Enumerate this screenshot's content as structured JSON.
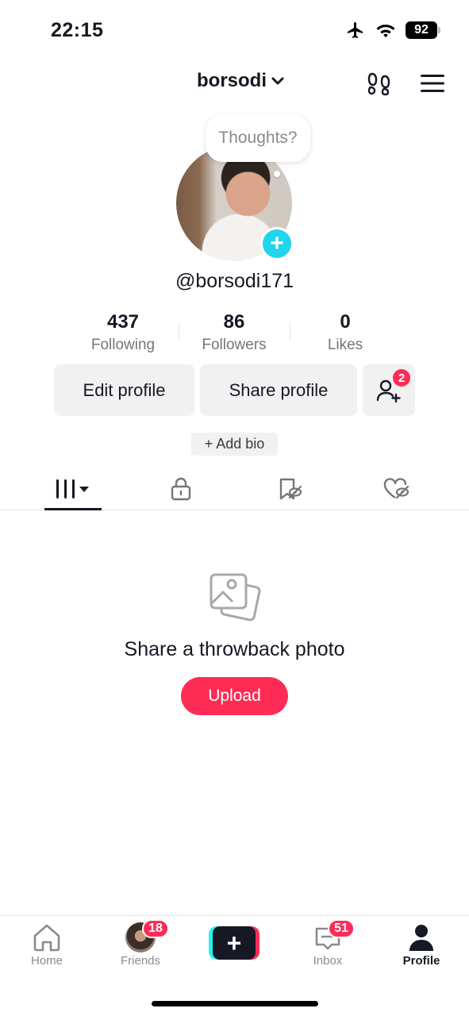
{
  "status_bar": {
    "time": "22:15",
    "battery": "92",
    "icons": [
      "airplane-icon",
      "wifi-icon",
      "battery-icon"
    ]
  },
  "header": {
    "username": "borsodi",
    "icons": [
      "chevron-down-icon",
      "footprint-icon",
      "menu-icon"
    ]
  },
  "profile": {
    "thought_bubble": "Thoughts?",
    "handle": "@borsodi171",
    "stats": [
      {
        "value": "437",
        "label": "Following"
      },
      {
        "value": "86",
        "label": "Followers"
      },
      {
        "value": "0",
        "label": "Likes"
      }
    ],
    "edit_profile_label": "Edit profile",
    "share_profile_label": "Share profile",
    "add_friends_badge": "2",
    "add_bio_label": "+ Add bio"
  },
  "tabs": [
    "videos-grid-icon",
    "lock-icon",
    "saved-hidden-icon",
    "liked-hidden-icon"
  ],
  "empty_state": {
    "title": "Share a throwback photo",
    "button_label": "Upload"
  },
  "bottom_nav": {
    "items": [
      {
        "label": "Home",
        "badge": ""
      },
      {
        "label": "Friends",
        "badge": "18"
      },
      {
        "label": "",
        "badge": ""
      },
      {
        "label": "Inbox",
        "badge": "51"
      },
      {
        "label": "Profile",
        "badge": ""
      }
    ],
    "create_symbol": "+"
  },
  "colors": {
    "accent": "#fe2c55",
    "cyan": "#20d5ec",
    "text": "#161823",
    "muted": "#8a8b91",
    "button_bg": "#f1f1f2"
  }
}
